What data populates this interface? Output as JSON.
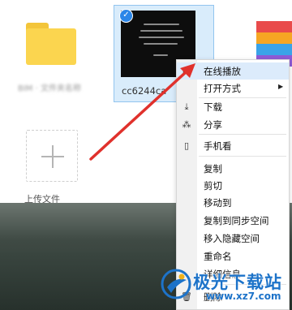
{
  "files": {
    "folder_name": "BIM · 文件夹名称",
    "selected_file_name": "cc6244ca",
    "upload_label": "上传文件"
  },
  "thumbnail": {
    "text_lines": [
      "\"万里羊群白浪翻 但也更多\"",
      "出生在大地之上 终将在更广阔",
      "…… 一颗"
    ]
  },
  "context_menu": {
    "items": [
      {
        "label": "在线播放",
        "icon": "play-icon",
        "submenu": false
      },
      {
        "label": "打开方式",
        "icon": "",
        "submenu": true
      },
      {
        "label": "下载",
        "icon": "download-icon",
        "submenu": false
      },
      {
        "label": "分享",
        "icon": "share-icon",
        "submenu": false
      },
      {
        "label": "手机看",
        "icon": "phone-icon",
        "submenu": false
      },
      {
        "label": "复制",
        "icon": "",
        "submenu": false
      },
      {
        "label": "剪切",
        "icon": "",
        "submenu": false
      },
      {
        "label": "移动到",
        "icon": "",
        "submenu": false
      },
      {
        "label": "复制到同步空间",
        "icon": "",
        "submenu": false
      },
      {
        "label": "移入隐藏空间",
        "icon": "",
        "submenu": false
      },
      {
        "label": "重命名",
        "icon": "",
        "submenu": false
      },
      {
        "label": "详细信息",
        "icon": "",
        "submenu": false
      },
      {
        "label": "删除",
        "icon": "trash-icon",
        "submenu": false
      }
    ]
  },
  "watermark": {
    "brand": "极光下载站",
    "url": "www.xz7.com"
  },
  "colors": {
    "selection_bg": "#d9ecfb",
    "menu_highlight": "#dcebfb",
    "arrow": "#e0312c",
    "brand_blue": "#1d73c9"
  }
}
